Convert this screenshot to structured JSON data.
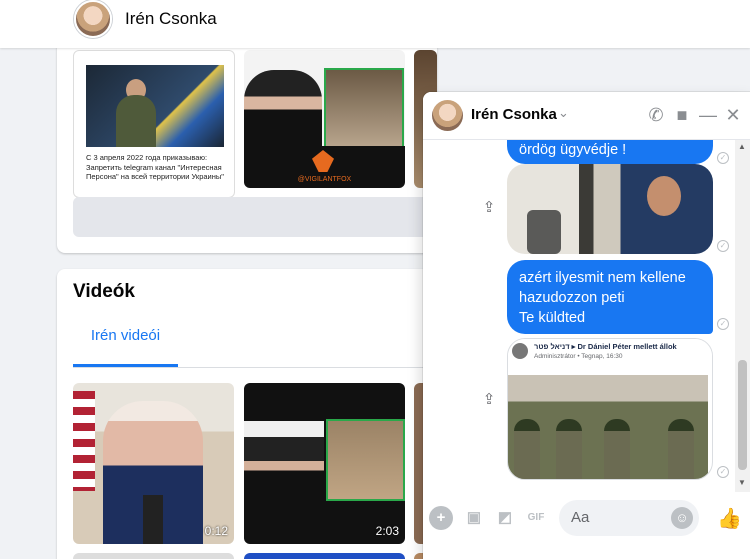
{
  "profile": {
    "name": "Irén Csonka"
  },
  "photos": {
    "thumb1_caption": "С 3 апреля 2022 года приказываю: Запретить telegram канал \"Интересная Персона\" на всей территории Украины\"",
    "thumb2_brand": "@VIGILANTFOX"
  },
  "videos_section": {
    "title": "Videók",
    "tab_label": "Irén videói",
    "items": [
      {
        "duration": "0:12"
      },
      {
        "duration": "2:03"
      }
    ]
  },
  "chat": {
    "contact_name": "Irén Csonka",
    "messages": {
      "m0": "ördög ügyvédje !",
      "m1": "azért ilyesmit nem kellene hazudozzon peti",
      "m1_sent": "Te küldted"
    },
    "shared_post": {
      "title": "דניאל פטר ▸ Dr Dániel Péter mellett állok",
      "subtitle": "Adminisztrátor • Tegnap, 16:30"
    },
    "composer_placeholder": "Aa"
  },
  "colors": {
    "accent": "#1877f2",
    "bubble_text": "#ffffff",
    "background": "#f0f2f5"
  },
  "icons": [
    "chevron-down-icon",
    "phone-icon",
    "video-call-icon",
    "minimize-icon",
    "close-icon",
    "share-icon",
    "seen-check-icon",
    "plus-icon",
    "photo-icon",
    "sticker-icon",
    "gif-icon",
    "emoji-icon",
    "like-icon"
  ]
}
